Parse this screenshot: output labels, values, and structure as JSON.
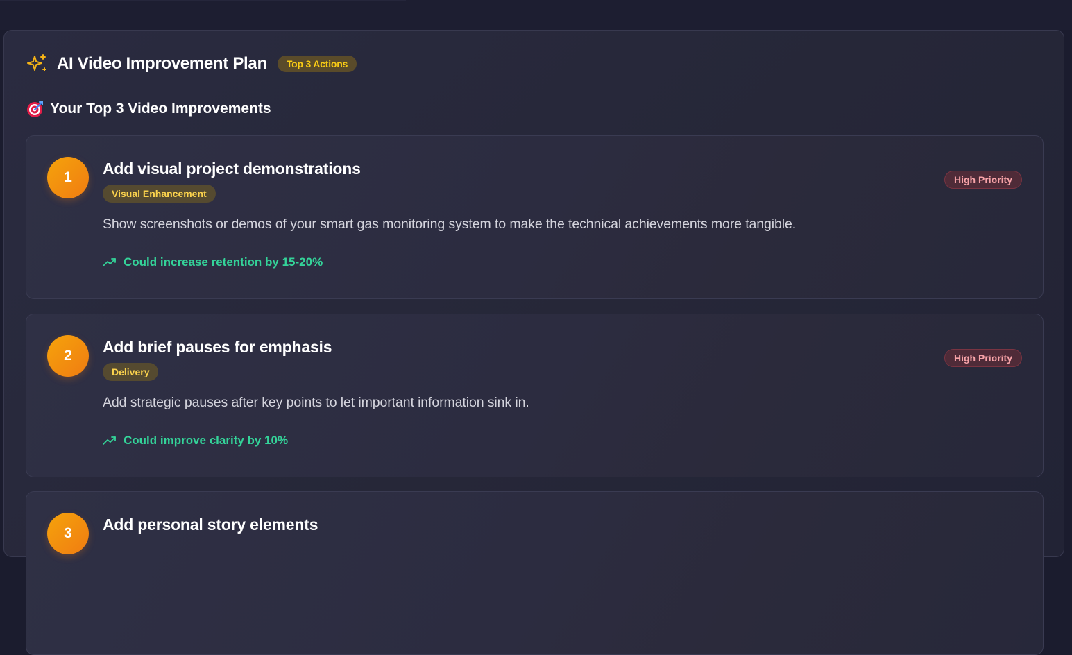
{
  "header": {
    "title": "AI Video Improvement Plan",
    "badge": "Top 3 Actions",
    "icon": "sparkles-icon"
  },
  "section": {
    "heading": "Your Top 3 Video Improvements",
    "icon": "target-icon"
  },
  "improvements": [
    {
      "number": "1",
      "title": "Add visual project demonstrations",
      "category": "Visual Enhancement",
      "priority": "High Priority",
      "description": "Show screenshots or demos of your smart gas monitoring system to make the technical achievements more tangible.",
      "impact": "Could increase retention by 15-20%"
    },
    {
      "number": "2",
      "title": "Add brief pauses for emphasis",
      "category": "Delivery",
      "priority": "High Priority",
      "description": "Add strategic pauses after key points to let important information sink in.",
      "impact": "Could improve clarity by 10%"
    },
    {
      "number": "3",
      "title": "Add personal story elements"
    }
  ],
  "colors": {
    "accent": "#f59e0b",
    "badge_text": "#facc15",
    "priority_text": "#f7a3a8",
    "impact_text": "#34d399",
    "background": "#1b1c2e"
  }
}
